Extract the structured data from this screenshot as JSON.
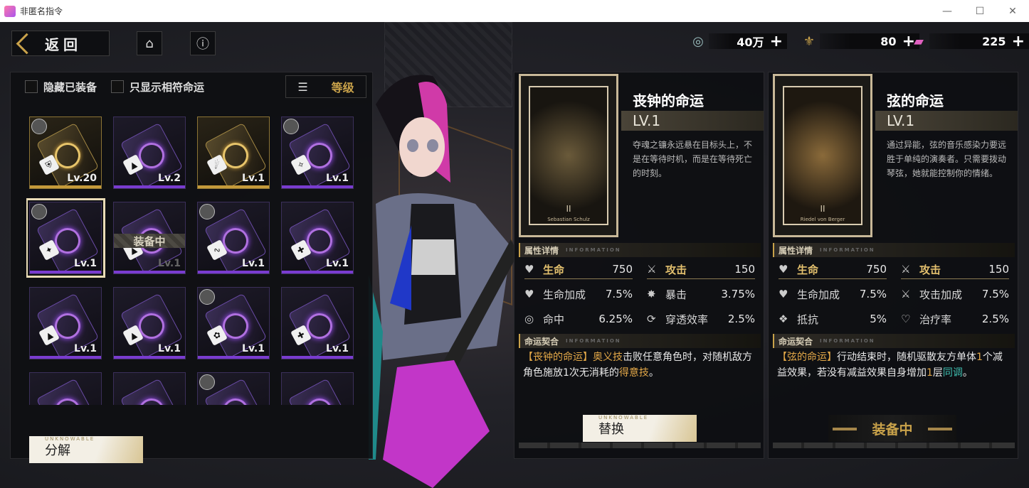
{
  "window": {
    "title": "非匿名指令",
    "controls": [
      "—",
      "☐",
      "✕"
    ]
  },
  "topbar": {
    "back_label": "返回",
    "home_icon": "home-icon",
    "info_icon": "info-icon",
    "resources": [
      {
        "icon": "credit-icon",
        "value": "40万"
      },
      {
        "icon": "fleur-icon",
        "value": "80"
      },
      {
        "icon": "ticket-icon",
        "value": "225"
      }
    ],
    "plus": "+"
  },
  "left_panel": {
    "filter_hide_equipped": "隐藏已装备",
    "filter_match_fate": "只显示相符命运",
    "sort_label": "等级",
    "equipping_tag": "装备中",
    "cards": [
      {
        "lv": "Lv.20",
        "rarity": "gold",
        "avatar": true
      },
      {
        "lv": "Lv.2",
        "rarity": "purple"
      },
      {
        "lv": "Lv.1",
        "rarity": "gold"
      },
      {
        "lv": "Lv.1",
        "rarity": "purple",
        "avatar": true
      },
      {
        "lv": "Lv.1",
        "rarity": "purple",
        "avatar": true,
        "selected": true
      },
      {
        "lv": "Lv.1",
        "rarity": "purple",
        "equipped": true
      },
      {
        "lv": "Lv.1",
        "rarity": "purple",
        "avatar": true
      },
      {
        "lv": "Lv.1",
        "rarity": "purple"
      },
      {
        "lv": "Lv.1",
        "rarity": "purple"
      },
      {
        "lv": "Lv.1",
        "rarity": "purple"
      },
      {
        "lv": "Lv.1",
        "rarity": "purple",
        "avatar": true
      },
      {
        "lv": "Lv.1",
        "rarity": "purple"
      },
      {
        "lv": "",
        "rarity": "purple"
      },
      {
        "lv": "",
        "rarity": "purple"
      },
      {
        "lv": "",
        "rarity": "purple",
        "avatar": true
      },
      {
        "lv": "",
        "rarity": "purple"
      }
    ],
    "decompose_label": "分解",
    "button_small": "UNKNOWABLE"
  },
  "fate_panels": [
    {
      "name": "丧钟的命运",
      "level": "LV.1",
      "description": "夺魂之镰永远悬在目标头上，不是在等待时机，而是在等待死亡的时刻。",
      "card_numeral": "II",
      "card_caption": "Sebastian Schulz",
      "attr_title": "属性详情",
      "attr_en": "INFORMATION",
      "stats": [
        {
          "icon": "heart-icon",
          "key": "生命",
          "value": "750",
          "primary": true
        },
        {
          "icon": "sword-icon",
          "key": "攻击",
          "value": "150",
          "primary": true
        },
        {
          "icon": "heart-plus-icon",
          "key": "生命加成",
          "value": "7.5%"
        },
        {
          "icon": "burst-icon",
          "key": "暴击",
          "value": "3.75%"
        },
        {
          "icon": "target-icon",
          "key": "命中",
          "value": "6.25%"
        },
        {
          "icon": "pierce-icon",
          "key": "穿透效率",
          "value": "2.5%"
        }
      ],
      "contract_title": "命运契合",
      "contract_en": "INFORMATION",
      "skill": {
        "parts": [
          "【丧钟的命运】",
          "奥义技",
          "击败任意角色时，对随机敌方角色施放1次无消耗的",
          "得意技",
          "。"
        ]
      },
      "button": "替换",
      "button_small": "UNKNOWABLE"
    },
    {
      "name": "弦的命运",
      "level": "LV.1",
      "description": "通过异能，弦的音乐感染力要远胜于单纯的演奏者。只需要拨动琴弦，她就能控制你的情绪。",
      "card_numeral": "II",
      "card_caption": "Riedel von Berger",
      "attr_title": "属性详情",
      "attr_en": "INFORMATION",
      "stats": [
        {
          "icon": "heart-icon",
          "key": "生命",
          "value": "750",
          "primary": true
        },
        {
          "icon": "sword-icon",
          "key": "攻击",
          "value": "150",
          "primary": true
        },
        {
          "icon": "heart-plus-icon",
          "key": "生命加成",
          "value": "7.5%"
        },
        {
          "icon": "sword-plus-icon",
          "key": "攻击加成",
          "value": "7.5%"
        },
        {
          "icon": "resist-icon",
          "key": "抵抗",
          "value": "5%"
        },
        {
          "icon": "heal-icon",
          "key": "治疗率",
          "value": "2.5%"
        }
      ],
      "contract_title": "命运契合",
      "contract_en": "INFORMATION",
      "skill": {
        "parts": [
          "【弦的命运】",
          "行动结束时，随机驱散友方单体",
          "1",
          "个减益效果，若没有减益效果自身增加",
          "1",
          "层",
          "同调",
          "。"
        ]
      },
      "button": "装备中"
    }
  ],
  "colors": {
    "gold": "#c9a24a",
    "purple": "#7a3cd0",
    "teal": "#3fbfb0",
    "orange": "#e3a848"
  }
}
